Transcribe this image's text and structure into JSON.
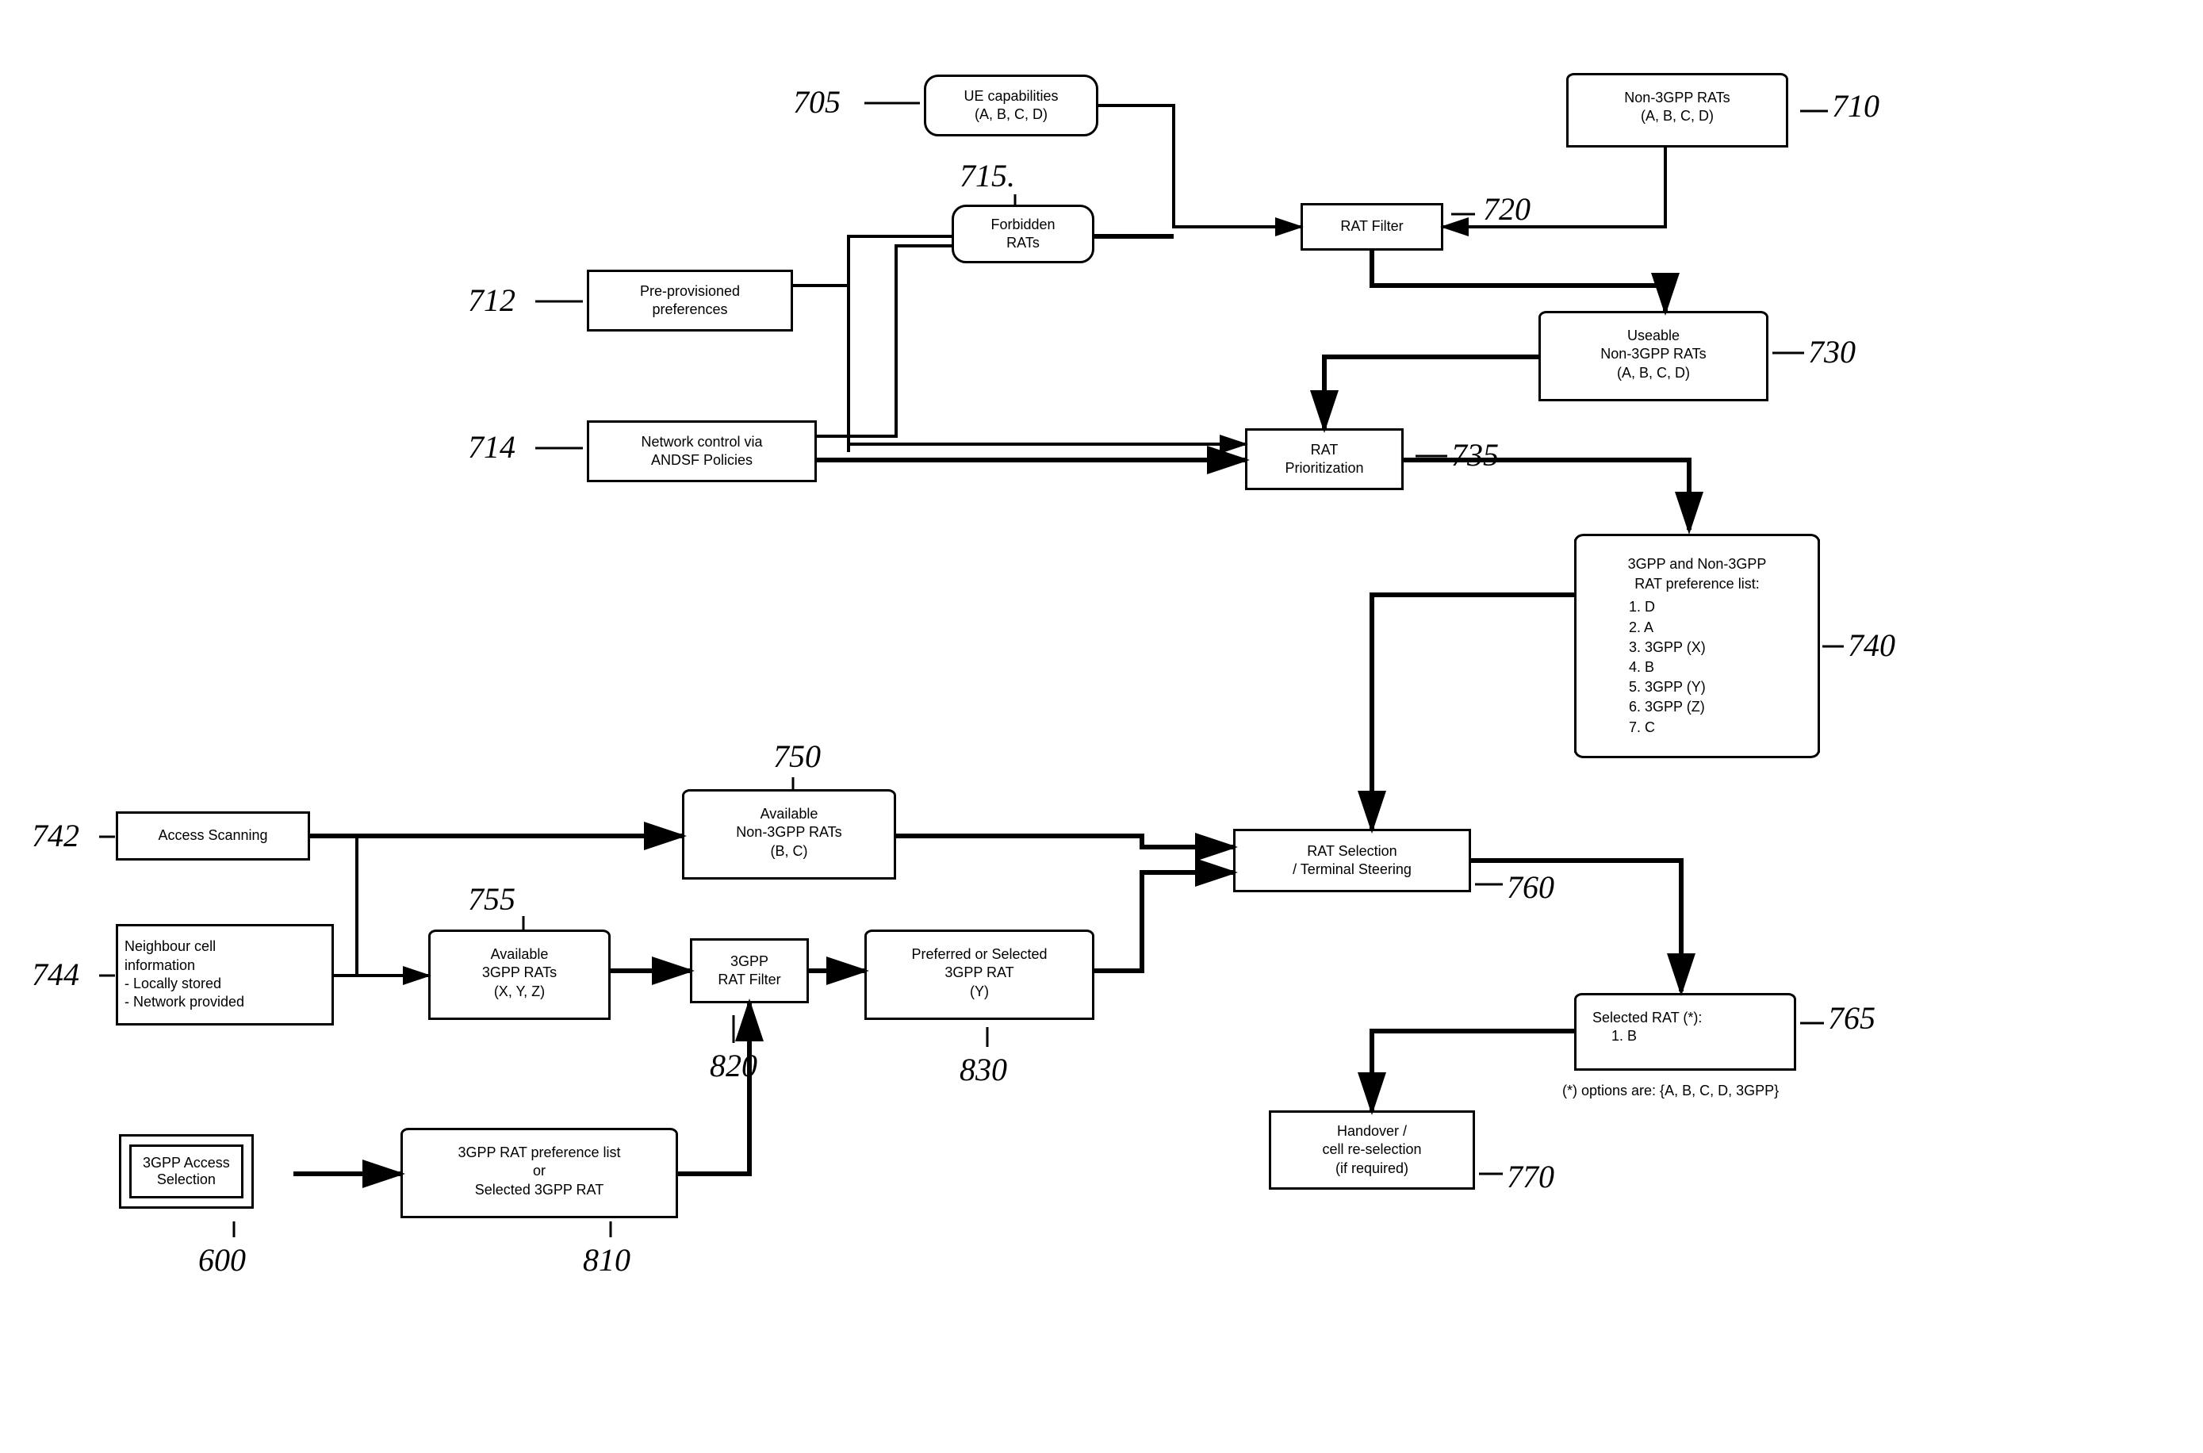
{
  "chart_data": {
    "type": "flowchart",
    "nodes": [
      {
        "id": "705",
        "label": "UE capabilities (A, B, C, D)",
        "shape": "rounded"
      },
      {
        "id": "710",
        "label": "Non-3GPP RATs (A, B, C, D)",
        "shape": "document"
      },
      {
        "id": "712",
        "label": "Pre-provisioned preferences",
        "shape": "rect"
      },
      {
        "id": "714",
        "label": "Network control via ANDSF Policies",
        "shape": "rect"
      },
      {
        "id": "715",
        "label": "Forbidden RATs",
        "shape": "rounded"
      },
      {
        "id": "720",
        "label": "RAT Filter",
        "shape": "rect"
      },
      {
        "id": "730",
        "label": "Useable Non-3GPP RATs (A, B, C, D)",
        "shape": "document"
      },
      {
        "id": "735",
        "label": "RAT Prioritization",
        "shape": "rect"
      },
      {
        "id": "740",
        "label": "3GPP and Non-3GPP RAT preference list: 1. D 2. A 3. 3GPP (X) 4. B 5. 3GPP (Y) 6. 3GPP (Z) 7. C",
        "shape": "scroll"
      },
      {
        "id": "742",
        "label": "Access Scanning",
        "shape": "rect"
      },
      {
        "id": "744",
        "label": "Neighbour cell information - Locally stored - Network provided",
        "shape": "rect"
      },
      {
        "id": "750",
        "label": "Available Non-3GPP RATs (B, C)",
        "shape": "document"
      },
      {
        "id": "755",
        "label": "Available 3GPP RATs (X, Y, Z)",
        "shape": "document"
      },
      {
        "id": "760",
        "label": "RAT Selection / Terminal Steering",
        "shape": "rect"
      },
      {
        "id": "765",
        "label": "Selected RAT (*): 1. B  (*) options are: {A, B, C, D, 3GPP}",
        "shape": "document"
      },
      {
        "id": "770",
        "label": "Handover / cell re-selection (if required)",
        "shape": "rect"
      },
      {
        "id": "600",
        "label": "3GPP Access Selection",
        "shape": "double"
      },
      {
        "id": "810",
        "label": "3GPP RAT preference list or Selected 3GPP RAT",
        "shape": "document"
      },
      {
        "id": "820",
        "label": "3GPP RAT Filter",
        "shape": "rect"
      },
      {
        "id": "830",
        "label": "Preferred or Selected 3GPP RAT (Y)",
        "shape": "document"
      }
    ],
    "edges": [
      {
        "from": "705",
        "to": "720"
      },
      {
        "from": "710",
        "to": "720"
      },
      {
        "from": "712",
        "to": "715"
      },
      {
        "from": "715",
        "to": "720"
      },
      {
        "from": "712",
        "to": "735_via_junction"
      },
      {
        "from": "714",
        "to": "715"
      },
      {
        "from": "714",
        "to": "735"
      },
      {
        "from": "720",
        "to": "730"
      },
      {
        "from": "730",
        "to": "735"
      },
      {
        "from": "735",
        "to": "740"
      },
      {
        "from": "740",
        "to": "760"
      },
      {
        "from": "742",
        "to": "750"
      },
      {
        "from": "742",
        "to": "755_junction"
      },
      {
        "from": "744",
        "to": "755"
      },
      {
        "from": "750",
        "to": "760"
      },
      {
        "from": "755",
        "to": "820"
      },
      {
        "from": "810",
        "to": "820"
      },
      {
        "from": "820",
        "to": "830"
      },
      {
        "from": "830",
        "to": "760"
      },
      {
        "from": "600",
        "to": "810"
      },
      {
        "from": "760",
        "to": "765"
      },
      {
        "from": "765",
        "to": "770"
      }
    ]
  },
  "nodes": {
    "n705": {
      "l1": "UE capabilities",
      "l2": "(A, B, C, D)"
    },
    "n710": {
      "l1": "Non-3GPP RATs",
      "l2": "(A, B, C, D)"
    },
    "n712": {
      "l1": "Pre-provisioned",
      "l2": "preferences"
    },
    "n714": {
      "l1": "Network control via",
      "l2": "ANDSF Policies"
    },
    "n715": {
      "l1": "Forbidden",
      "l2": "RATs"
    },
    "n720": "RAT Filter",
    "n730": {
      "l1": "Useable",
      "l2": "Non-3GPP RATs",
      "l3": "(A, B, C, D)"
    },
    "n735": {
      "l1": "RAT",
      "l2": "Prioritization"
    },
    "n740": {
      "hdr1": "3GPP and Non-3GPP",
      "hdr2": "RAT preference list:",
      "i1": "1. D",
      "i2": "2. A",
      "i3": "3. 3GPP (X)",
      "i4": "4. B",
      "i5": "5. 3GPP (Y)",
      "i6": "6. 3GPP (Z)",
      "i7": "7. C"
    },
    "n742": "Access Scanning",
    "n744": {
      "l1": "Neighbour cell",
      "l2": "information",
      "l3": "- Locally stored",
      "l4": "- Network provided"
    },
    "n750": {
      "l1": "Available",
      "l2": "Non-3GPP RATs",
      "l3": "(B, C)"
    },
    "n755": {
      "l1": "Available",
      "l2": "3GPP RATs",
      "l3": "(X, Y, Z)"
    },
    "n760": {
      "l1": "RAT Selection",
      "l2": "/ Terminal Steering"
    },
    "n765": {
      "l1": "Selected RAT (*):",
      "l2": "1. B"
    },
    "n765note": "(*) options are: {A, B, C, D, 3GPP}",
    "n770": {
      "l1": "Handover /",
      "l2": "cell re-selection",
      "l3": "(if required)"
    },
    "n600": {
      "l1": "3GPP Access",
      "l2": "Selection"
    },
    "n810": {
      "l1": "3GPP RAT preference list",
      "l2": "or",
      "l3": "Selected 3GPP RAT"
    },
    "n820": {
      "l1": "3GPP",
      "l2": "RAT Filter"
    },
    "n830": {
      "l1": "Preferred or Selected",
      "l2": "3GPP RAT",
      "l3": "(Y)"
    }
  },
  "labels": {
    "l705": "705",
    "l710": "710",
    "l712": "712",
    "l714": "714",
    "l715": "715.",
    "l720": "720",
    "l730": "730",
    "l735": "735",
    "l740": "740",
    "l742": "742",
    "l744": "744",
    "l750": "750",
    "l755": "755",
    "l760": "760",
    "l765": "765",
    "l770": "770",
    "l600": "600",
    "l810": "810",
    "l820": "820",
    "l830": "830"
  }
}
